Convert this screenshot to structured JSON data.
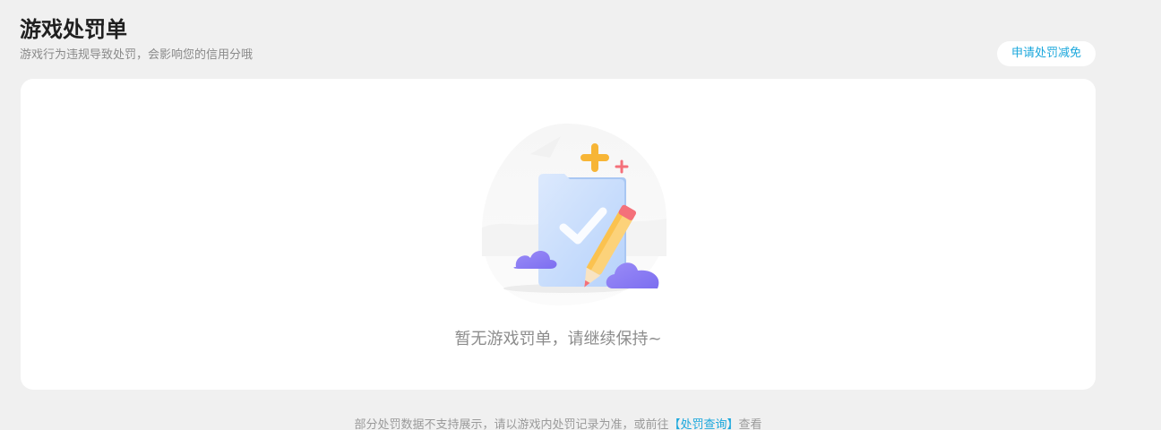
{
  "header": {
    "title": "游戏处罚单",
    "subtitle": "游戏行为违规导致处罚，会影响您的信用分哦",
    "appeal_button": "申请处罚减免"
  },
  "empty_state": {
    "message": "暂无游戏罚单，请继续保持~",
    "illustration_icon": "clipboard-checkmark-pencil-icon"
  },
  "footer": {
    "note_before": "部分处罚数据不支持展示，请以游戏内处罚记录为准，或前往",
    "link_text": "【处罚查询】",
    "note_after": "查看"
  },
  "colors": {
    "background": "#f0f0f0",
    "card": "#ffffff",
    "accent": "#1aa7dc",
    "title": "#1f1f1f",
    "muted": "#8c8c8c"
  }
}
